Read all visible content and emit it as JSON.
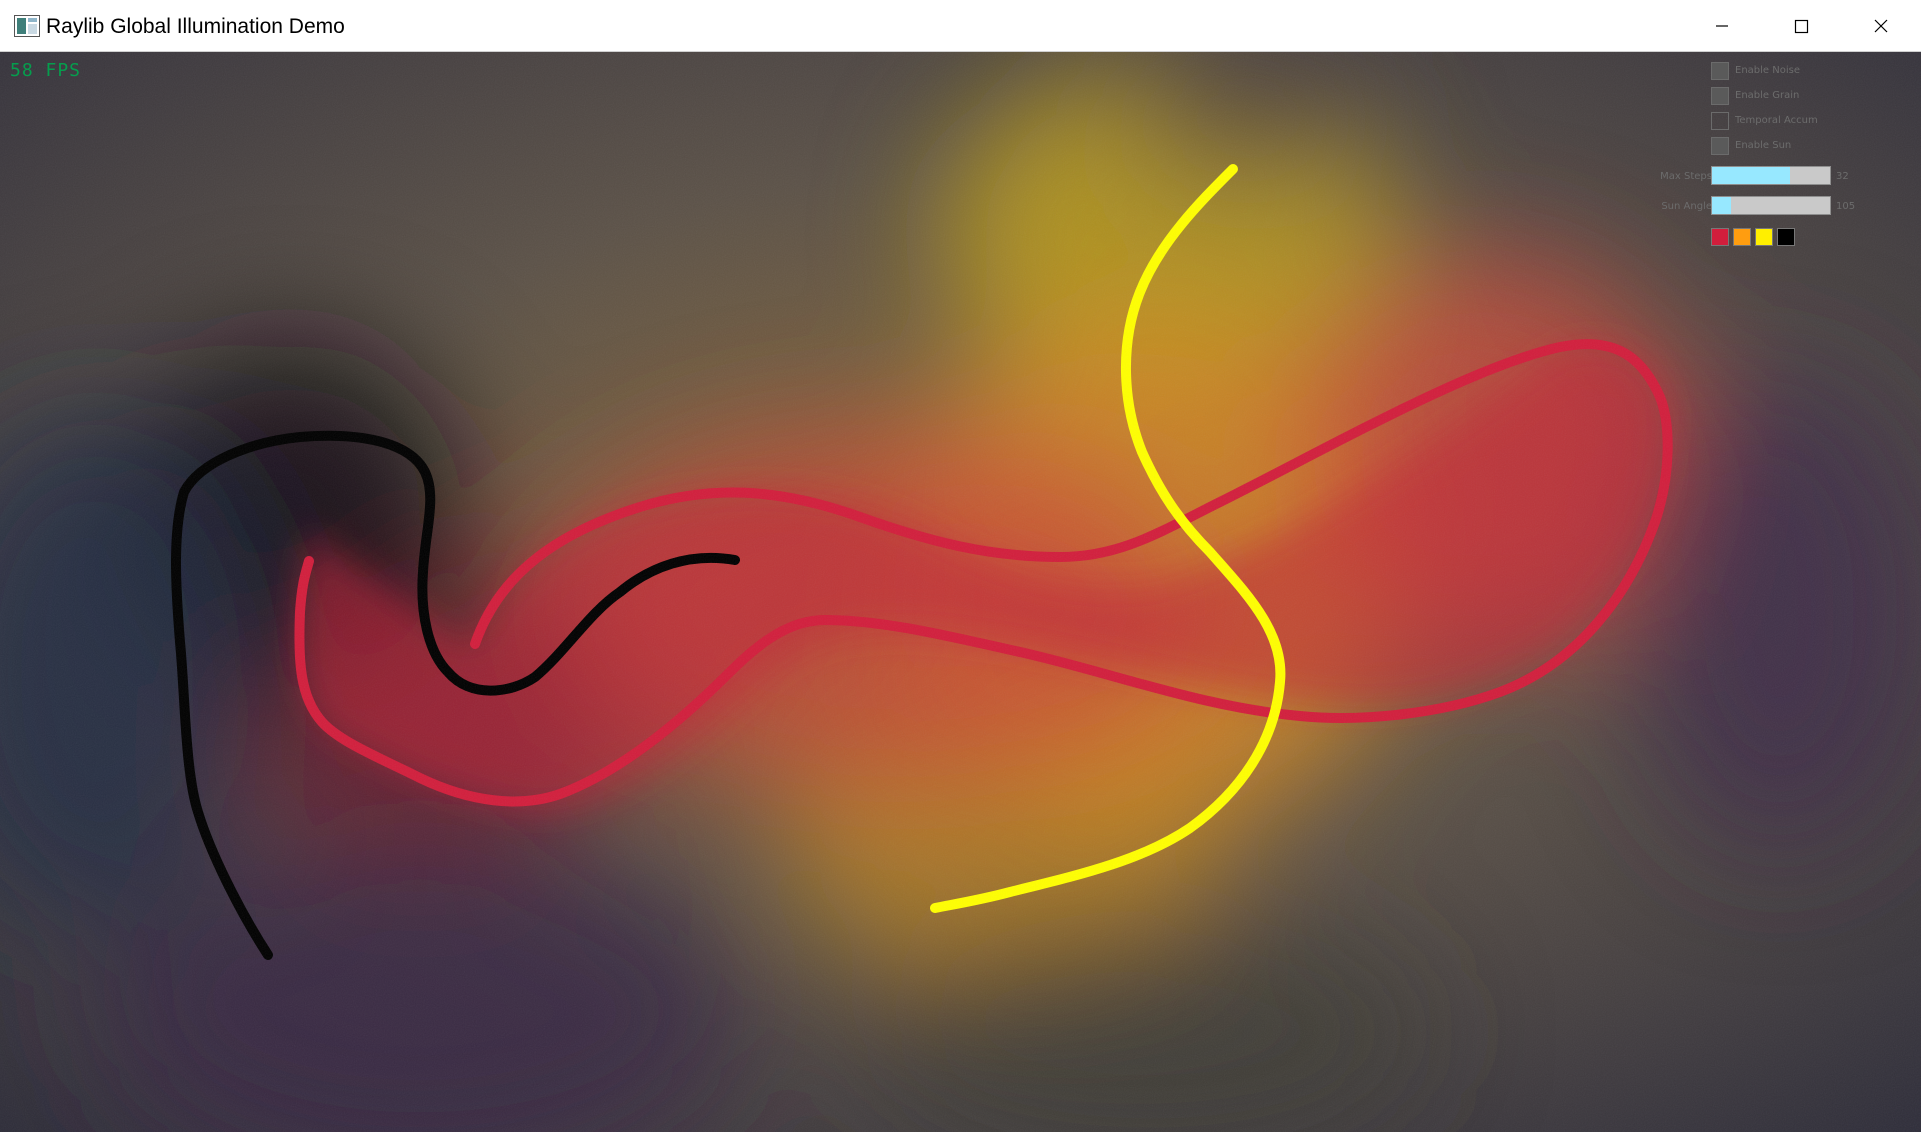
{
  "window": {
    "title": "Raylib Global Illumination Demo",
    "controls": [
      "minimize",
      "maximize",
      "close"
    ]
  },
  "hud": {
    "fps": "58 FPS"
  },
  "panel": {
    "checkboxes": [
      {
        "label": "Enable Noise",
        "checked": true
      },
      {
        "label": "Enable Grain",
        "checked": true
      },
      {
        "label": "Temporal Accum",
        "checked": false
      },
      {
        "label": "Enable Sun",
        "checked": true
      }
    ],
    "sliders": [
      {
        "label": "Max Steps",
        "value": "32",
        "fraction": 0.66
      },
      {
        "label": "Sun Angle",
        "value": "105",
        "fraction": 0.16
      }
    ],
    "palette": [
      {
        "name": "crimson-swatch",
        "color": "#d21e3c"
      },
      {
        "name": "orange-swatch",
        "color": "#ff9d10"
      },
      {
        "name": "yellow-swatch",
        "color": "#ffef00"
      },
      {
        "name": "black-swatch",
        "color": "#000000"
      }
    ]
  },
  "colors": {
    "crimson_stroke": "#d21e3c",
    "yellow_stroke": "#ffff00",
    "black_stroke": "#000000",
    "fps_text": "#00a84f"
  }
}
